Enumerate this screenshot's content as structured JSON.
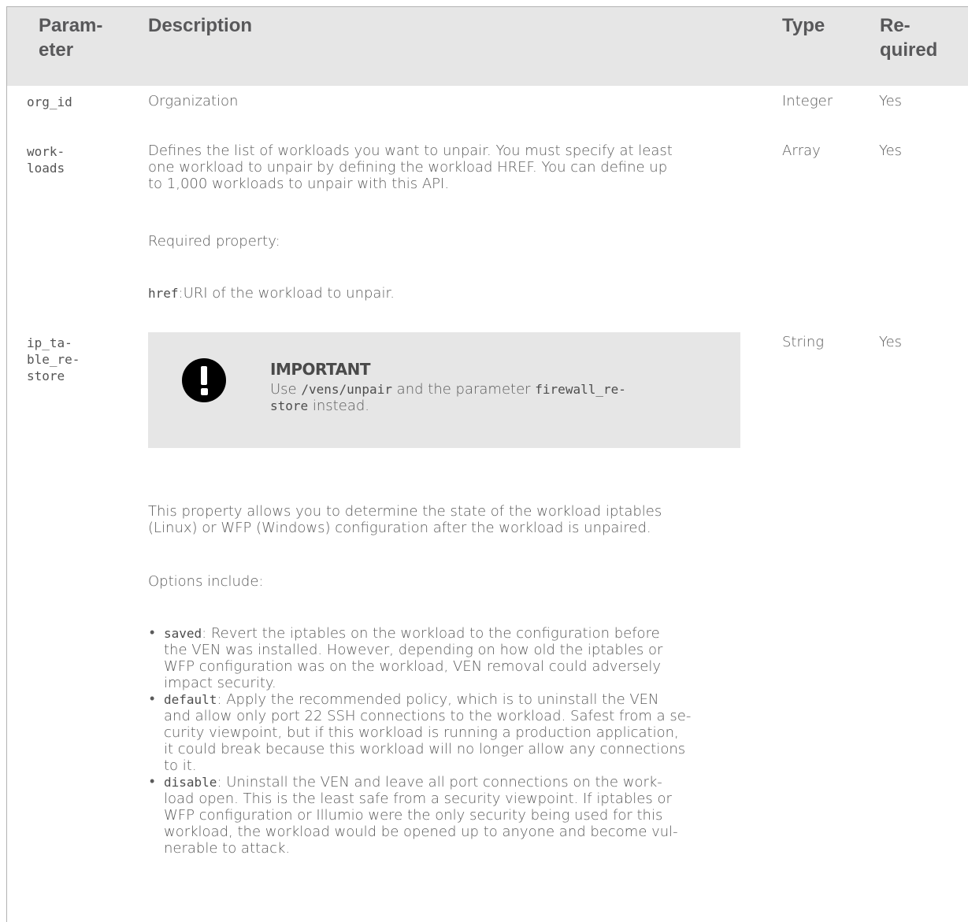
{
  "table": {
    "headers": {
      "parameter": "Param-\neter",
      "description": "Description",
      "type": "Type",
      "required": "Re-\nquired"
    },
    "rows": [
      {
        "param": "org_id",
        "description": "Organization",
        "type": "Integer",
        "required": "Yes"
      },
      {
        "param": "work-\nloads",
        "description_lines": [
          "Defines the list of workloads you want to unpair. You must specify at least",
          "one workload to unpair by defining the workload HREF. You can define up",
          "to 1,000 workloads to unpair with this API."
        ],
        "required_property_label": "Required property:",
        "href_code": "href",
        "href_text": ":URI of the workload to unpair.",
        "type": "Array",
        "required": "Yes"
      },
      {
        "param": "ip_ta-\nble_re-\nstore",
        "type": "String",
        "required": "Yes",
        "important": {
          "icon": "exclamation-circle-icon",
          "title": "IMPORTANT",
          "text_use": "Use ",
          "code_path": "/vens/unpair",
          "text_mid": " and the parameter ",
          "code_param_1": "firewall_re-",
          "code_param_2": "store",
          "text_end": " instead."
        },
        "intro_lines": [
          "This property allows you to determine the state of the workload iptables",
          "(Linux) or WFP (Windows) configuration after the workload is unpaired."
        ],
        "options_label": "Options include:",
        "options": [
          {
            "code": "saved",
            "lines": [
              ": Revert the iptables on the workload to the configuration before",
              "the VEN was installed. However, depending on how old the iptables or",
              "WFP configuration was on the workload, VEN removal could adversely",
              "impact security."
            ]
          },
          {
            "code": "default",
            "lines": [
              ": Apply the recommended policy, which is to uninstall the VEN",
              "and allow only port 22 SSH connections to the workload. Safest from a se-",
              "curity viewpoint, but if this workload is running a production application,",
              "it could break because this workload will no longer allow any connections",
              "to it."
            ]
          },
          {
            "code": "disable",
            "lines": [
              ": Uninstall the VEN and leave all port connections on the work-",
              "load open. This is the least safe from a security viewpoint. If iptables or",
              "WFP configuration or Illumio were the only security being used for this",
              "workload, the workload would be opened up to anyone and become vul-",
              "nerable to attack."
            ]
          }
        ]
      }
    ]
  },
  "colors": {
    "header_bg": "#e6e6e6",
    "callout_bg": "#e6e6e6",
    "text": "#5a5a5a"
  }
}
